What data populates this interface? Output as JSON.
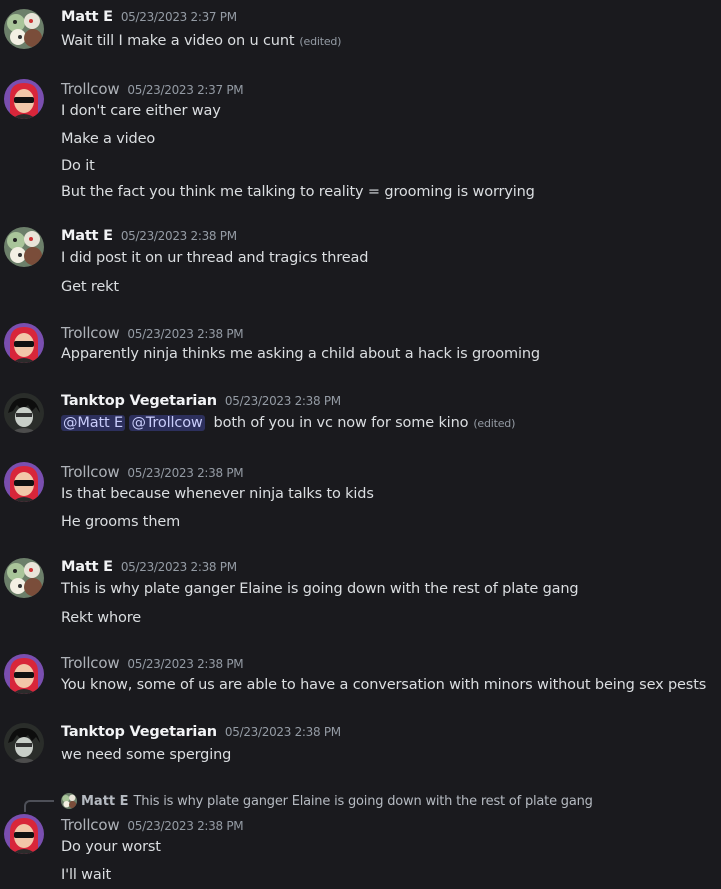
{
  "messages": [
    {
      "author": "Matt E",
      "time": "05/23/2023 2:37 PM",
      "lines": [
        "Wait till I make a video on u cunt"
      ],
      "edited": "(edited)"
    },
    {
      "author": "Trollcow",
      "time": "05/23/2023 2:37 PM",
      "lines": [
        "I don't care either way",
        "Make a video",
        "Do it",
        "But the fact you think me talking to reality = grooming is worrying"
      ]
    },
    {
      "author": "Matt E",
      "time": "05/23/2023 2:38 PM",
      "lines": [
        "I did post it on ur thread and tragics thread",
        "Get rekt"
      ]
    },
    {
      "author": "Trollcow",
      "time": "05/23/2023 2:38 PM",
      "lines": [
        "Apparently ninja thinks me asking a child about a hack is grooming"
      ]
    },
    {
      "author": "Tanktop Vegetarian",
      "time": "05/23/2023 2:38 PM",
      "mentions": [
        "@Matt E",
        "@Trollcow"
      ],
      "lines": [
        "both of you in vc now for some kino"
      ],
      "edited": "(edited)"
    },
    {
      "author": "Trollcow",
      "time": "05/23/2023 2:38 PM",
      "lines": [
        "Is that because whenever ninja talks to kids",
        "He grooms them"
      ]
    },
    {
      "author": "Matt E",
      "time": "05/23/2023 2:38 PM",
      "lines": [
        "This is why plate ganger Elaine is going down with the rest of plate gang",
        "Rekt whore"
      ]
    },
    {
      "author": "Trollcow",
      "time": "05/23/2023 2:38 PM",
      "lines": [
        "You know, some of us are able to have a conversation with minors without being sex pests"
      ]
    },
    {
      "author": "Tanktop Vegetarian",
      "time": "05/23/2023 2:38 PM",
      "lines": [
        "we need some sperging"
      ]
    },
    {
      "author": "Trollcow",
      "time": "05/23/2023 2:38 PM",
      "reply": {
        "author": "Matt E",
        "text": "This is why plate ganger Elaine is going down with the rest of plate gang"
      },
      "lines": [
        "Do your worst",
        "I'll wait"
      ]
    }
  ],
  "colors": {
    "background": "#1a1a1e",
    "mention_bg": "#3b3f74",
    "trollcow_name": "#aeb2b8"
  },
  "icons": {
    "matt": "cartoon-collage-avatar",
    "trollcow": "red-haired-sunglasses-avatar",
    "tanktop": "dark-anime-avatar"
  }
}
